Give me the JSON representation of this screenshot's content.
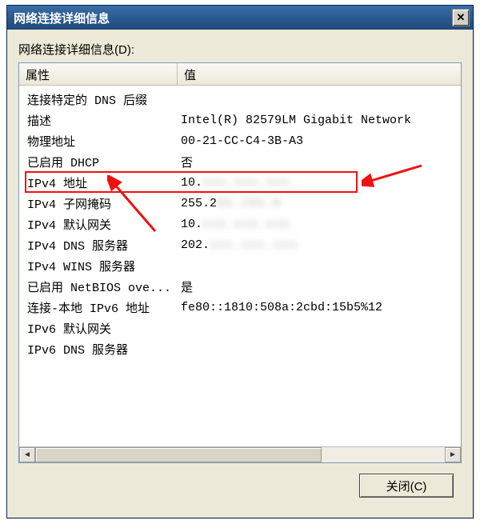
{
  "window": {
    "title": "网络连接详细信息",
    "close_glyph": "✕"
  },
  "header_label": "网络连接详细信息(D):",
  "columns": {
    "property": "属性",
    "value": "值"
  },
  "rows": [
    {
      "prop": "连接特定的 DNS 后缀",
      "val": ""
    },
    {
      "prop": "描述",
      "val": "Intel(R) 82579LM Gigabit Network"
    },
    {
      "prop": "物理地址",
      "val": "00-21-CC-C4-3B-A3"
    },
    {
      "prop": "已启用 DHCP",
      "val": "否"
    },
    {
      "prop": "IPv4 地址",
      "val_prefix": "10.",
      "val_blur": "xxx.xxx.xxx"
    },
    {
      "prop": "IPv4 子网掩码",
      "val_prefix": "255.2",
      "val_blur": "55.255.0"
    },
    {
      "prop": "IPv4 默认网关",
      "val_prefix": "10.",
      "val_blur": "xxx.xxx.xxx"
    },
    {
      "prop": "IPv4 DNS 服务器",
      "val_prefix": "202.",
      "val_blur": "xxx.xxx.xxx"
    },
    {
      "prop": "IPv4 WINS 服务器",
      "val": ""
    },
    {
      "prop": "已启用 NetBIOS ove...",
      "val": "是"
    },
    {
      "prop": "连接-本地 IPv6 地址",
      "val": "fe80::1810:508a:2cbd:15b5%12"
    },
    {
      "prop": "IPv6 默认网关",
      "val": ""
    },
    {
      "prop": "IPv6 DNS 服务器",
      "val": ""
    }
  ],
  "buttons": {
    "close": "关闭(C)"
  },
  "annotation": {
    "highlight_row_index": 4,
    "arrow_color": "#e11"
  }
}
